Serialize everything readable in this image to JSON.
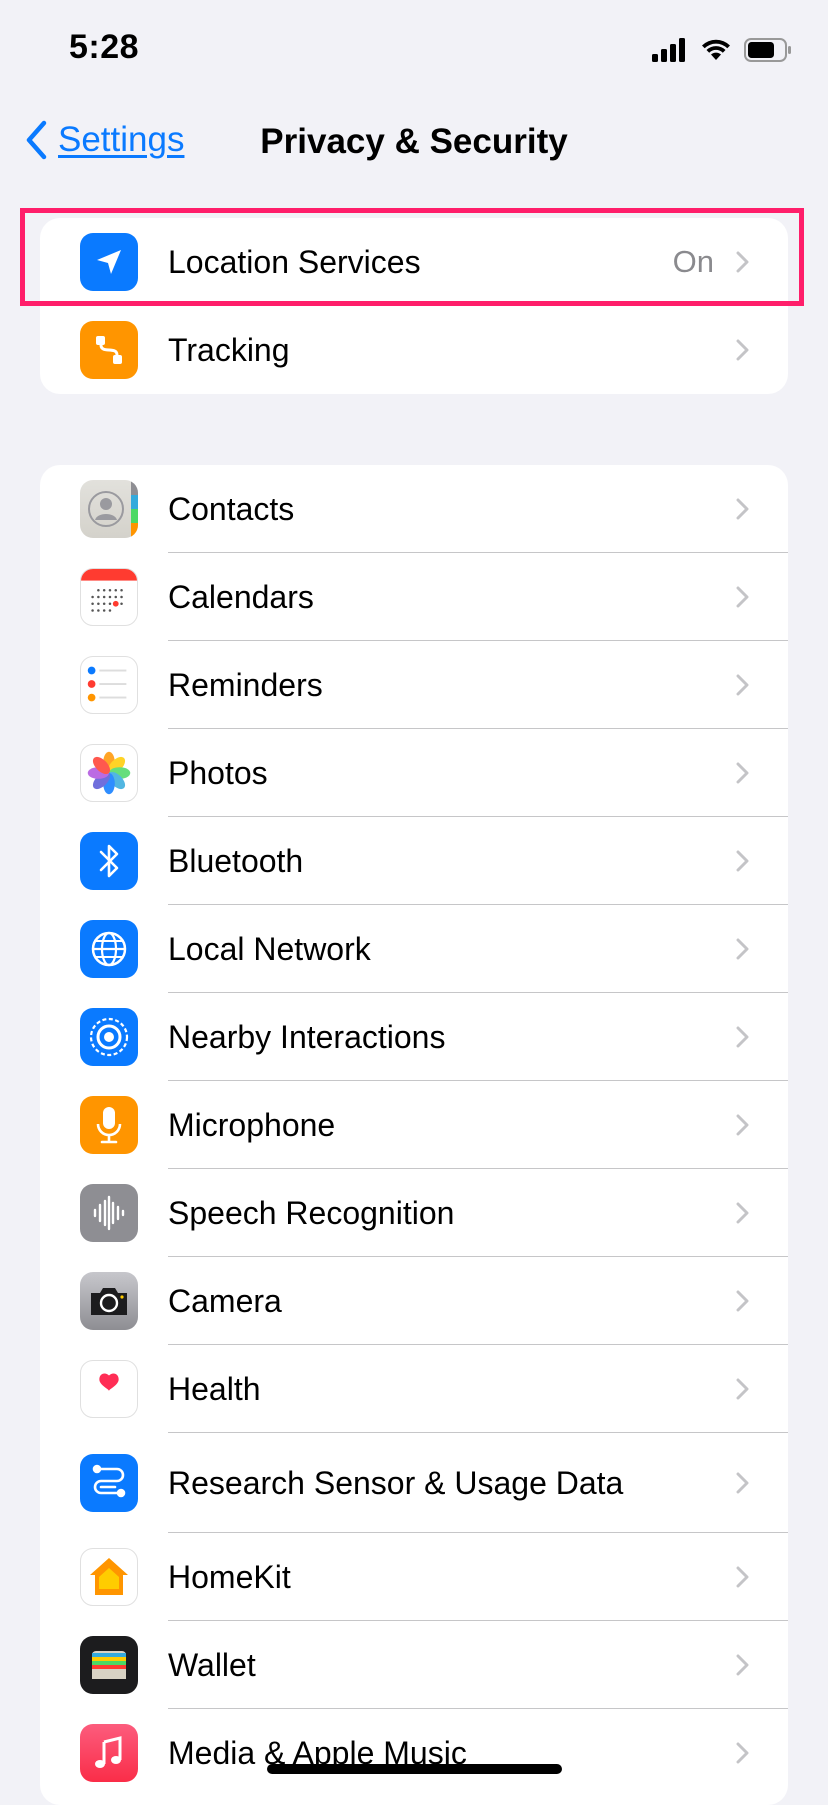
{
  "status_bar": {
    "time": "5:28"
  },
  "nav": {
    "back_label": "Settings",
    "title": "Privacy & Security"
  },
  "group1": [
    {
      "label": "Location Services",
      "value": "On",
      "icon": "location-arrow-icon",
      "color": "#0a7aff"
    },
    {
      "label": "Tracking",
      "value": "",
      "icon": "tracking-icon",
      "color": "#ff9500"
    }
  ],
  "group2": [
    {
      "label": "Contacts",
      "icon": "contacts-icon"
    },
    {
      "label": "Calendars",
      "icon": "calendar-icon"
    },
    {
      "label": "Reminders",
      "icon": "reminders-icon"
    },
    {
      "label": "Photos",
      "icon": "photos-icon"
    },
    {
      "label": "Bluetooth",
      "icon": "bluetooth-icon",
      "color": "#0a7aff"
    },
    {
      "label": "Local Network",
      "icon": "globe-icon",
      "color": "#0a7aff"
    },
    {
      "label": "Nearby Interactions",
      "icon": "nearby-icon",
      "color": "#0a7aff"
    },
    {
      "label": "Microphone",
      "icon": "microphone-icon",
      "color": "#ff9500"
    },
    {
      "label": "Speech Recognition",
      "icon": "waveform-icon",
      "color": "#8e8e93"
    },
    {
      "label": "Camera",
      "icon": "camera-icon",
      "color": "#8e8e93"
    },
    {
      "label": "Health",
      "icon": "heart-icon",
      "color": "#ff2d55"
    },
    {
      "label": "Research Sensor & Usage Data",
      "icon": "research-icon",
      "color": "#0a7aff"
    },
    {
      "label": "HomeKit",
      "icon": "home-icon",
      "color": "#ff9500"
    },
    {
      "label": "Wallet",
      "icon": "wallet-icon",
      "color": "#1c1c1e"
    },
    {
      "label": "Media & Apple Music",
      "icon": "music-note-icon",
      "color": "#fa2d48"
    }
  ],
  "colors": {
    "accent": "#0a7aff",
    "highlight": "#ff1e6a",
    "background": "#f2f2f7"
  }
}
